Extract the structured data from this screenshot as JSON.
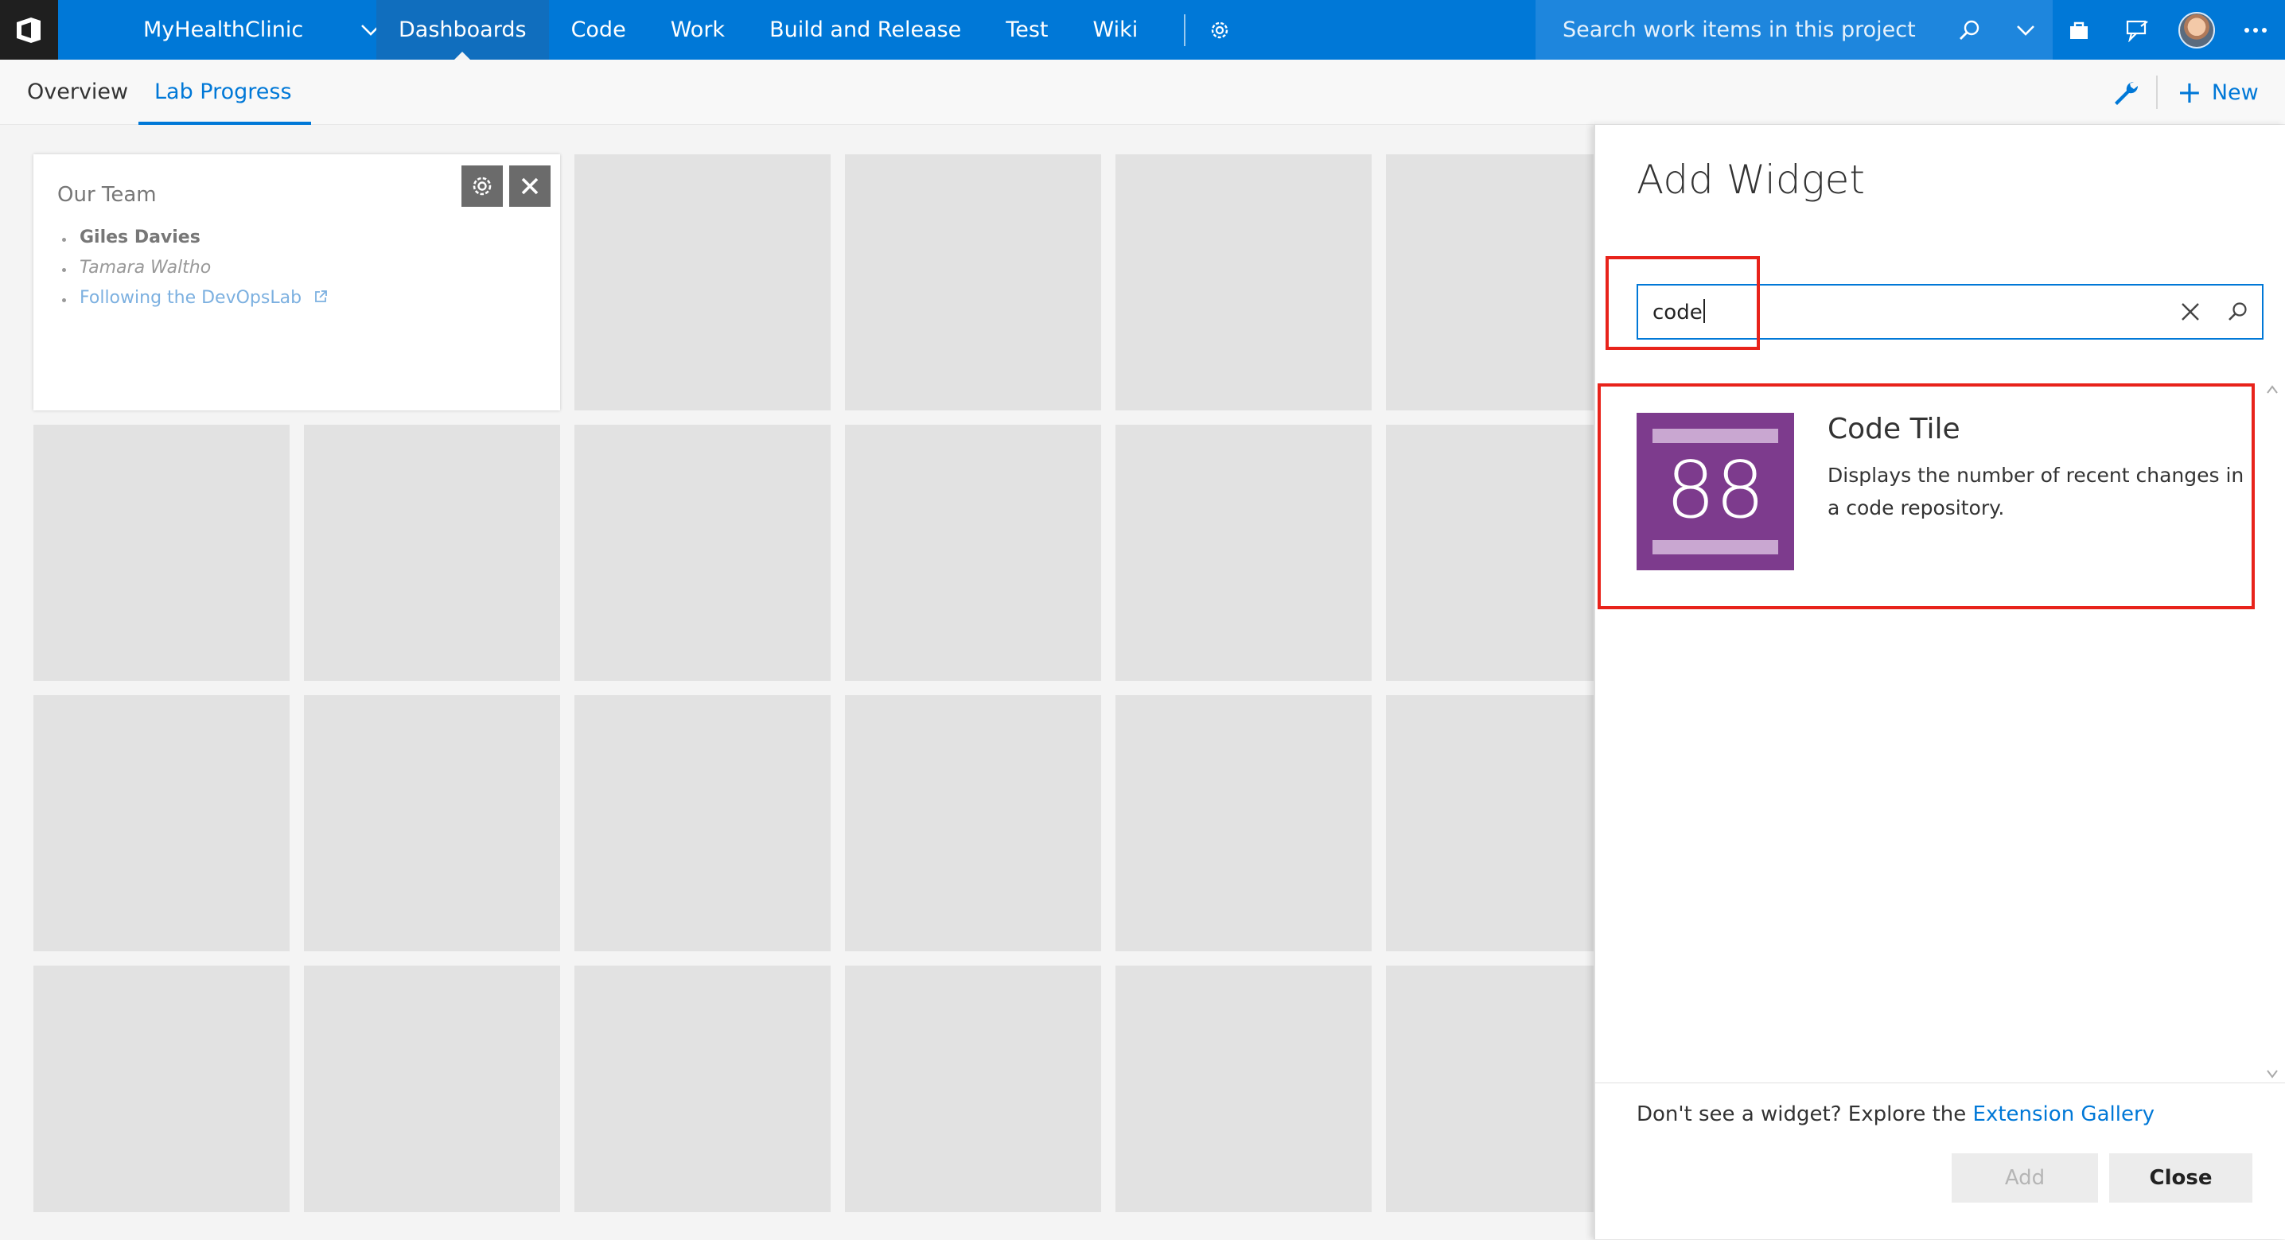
{
  "topbar": {
    "project_name": "MyHealthClinic",
    "hubs": [
      "Dashboards",
      "Code",
      "Work",
      "Build and Release",
      "Test",
      "Wiki"
    ],
    "active_hub": "Dashboards",
    "search_placeholder": "Search work items in this project"
  },
  "subnav": {
    "tabs": [
      "Overview",
      "Lab Progress"
    ],
    "active_tab": "Lab Progress",
    "new_label": "New"
  },
  "team_widget": {
    "title": "Our Team",
    "members": [
      "Giles Davies",
      "Tamara Waltho",
      "Following the DevOpsLab"
    ]
  },
  "add_widget": {
    "title": "Add Widget",
    "search_value": "code",
    "results": [
      {
        "name": "Code Tile",
        "icon_number": "88",
        "description": "Displays the number of recent changes in a code repository."
      }
    ],
    "footer_text": "Don't see a widget? Explore the",
    "footer_link": "Extension Gallery",
    "add_button": "Add",
    "close_button": "Close"
  },
  "colors": {
    "brand_blue": "#0078d7",
    "highlight_red": "#e8231b",
    "tile_purple": "#7d3b8d"
  }
}
